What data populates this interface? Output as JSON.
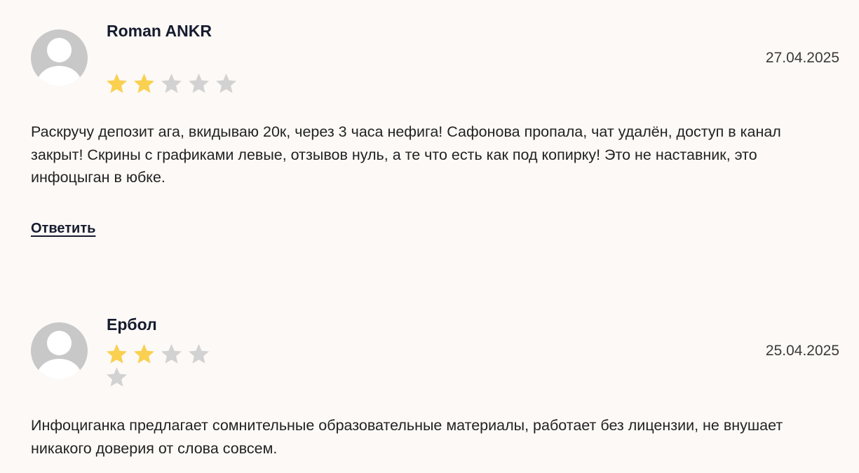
{
  "reviews": [
    {
      "author": "Roman ANKR",
      "date": "27.04.2025",
      "rating": 2,
      "max_rating": 5,
      "text": "Раскручу депозит ага, вкидываю 20к, через 3 часа нефига! Сафонова пропала, чат удалён, доступ в канал закрыт! Скрины с графиками левые, отзывов нуль, а те что есть как под копирку! Это не наставник, это инфоцыган в юбке.",
      "reply_label": "Ответить"
    },
    {
      "author": "Ербол",
      "date": "25.04.2025",
      "rating": 2,
      "max_rating": 5,
      "text": "Инфоциганка предлагает сомнительные образовательные материалы, работает без лицензии, не внушает никакого доверия от слова совсем."
    }
  ],
  "colors": {
    "background": "#fdf9f6",
    "star_filled": "#f9d050",
    "star_empty": "#d2d2d2",
    "avatar_bg": "#c8c8c8"
  },
  "icons": {
    "avatar": "user-placeholder-icon",
    "star": "star-icon"
  }
}
